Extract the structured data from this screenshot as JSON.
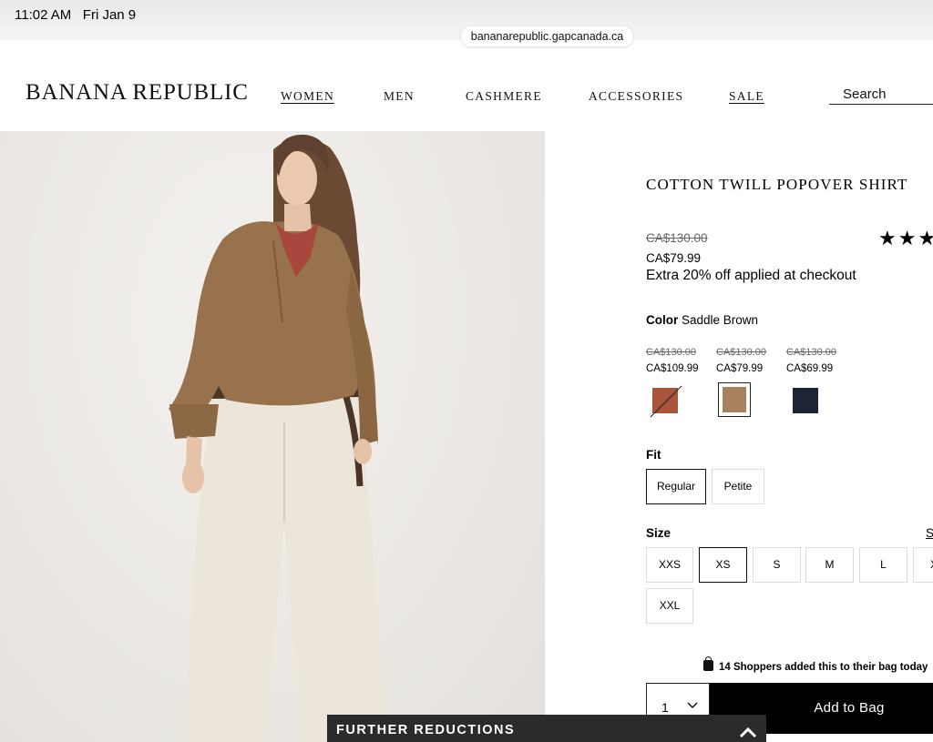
{
  "status_bar": {
    "time": "11:02 AM",
    "date": "Fri Jan 9",
    "url": "bananarepublic.gapcanada.ca"
  },
  "header": {
    "logo": "BANANA REPUBLIC",
    "nav": [
      "WOMEN",
      "MEN",
      "CASHMERE",
      "ACCESSORIES",
      "SALE"
    ],
    "search_placeholder": "Search"
  },
  "product": {
    "title": "COTTON TWILL POPOVER SHIRT",
    "rating_stars": "★★★",
    "price_original": "CA$130.00",
    "price_sale": "CA$79.99",
    "promo": "Extra 20% off applied at checkout",
    "color_label": "Color",
    "color_value": "Saddle Brown",
    "swatches": [
      {
        "old": "CA$130.00",
        "price": "CA$109.99",
        "color": "#a9553c",
        "unavailable": true
      },
      {
        "old": "CA$130.00",
        "price": "CA$79.99",
        "color": "#a8825f",
        "selected": true
      },
      {
        "old": "CA$130.00",
        "price": "CA$69.99",
        "color": "#1e2435"
      }
    ],
    "fit_label": "Fit",
    "fit_options": [
      "Regular",
      "Petite"
    ],
    "fit_selected": "Regular",
    "size_label": "Size",
    "size_guide": "S",
    "sizes": [
      "XXS",
      "XS",
      "S",
      "M",
      "L",
      "X",
      "XXL"
    ],
    "size_selected": "XS",
    "shoppers": "14 Shoppers added this to their bag today",
    "quantity": "1",
    "add_to_bag": "Add to Bag"
  },
  "banner": {
    "label": "FURTHER REDUCTIONS"
  }
}
